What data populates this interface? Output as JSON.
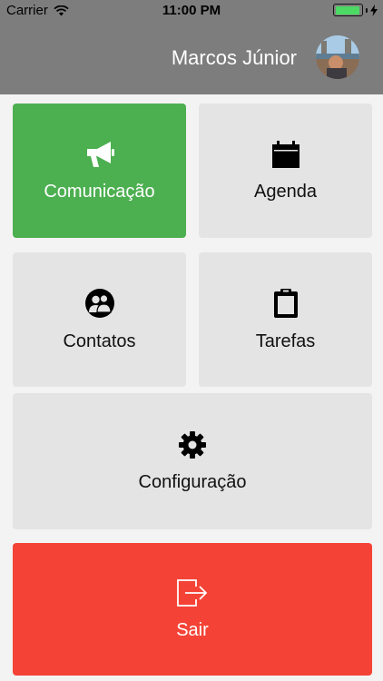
{
  "status_bar": {
    "carrier": "Carrier",
    "time": "11:00 PM",
    "battery_level": 0.95
  },
  "header": {
    "user_name": "Marcos Júnior"
  },
  "menu": {
    "comunicacao": {
      "label": "Comunicação",
      "icon": "megaphone-icon",
      "color": "#4caf50"
    },
    "agenda": {
      "label": "Agenda",
      "icon": "calendar-icon"
    },
    "contatos": {
      "label": "Contatos",
      "icon": "contacts-icon"
    },
    "tarefas": {
      "label": "Tarefas",
      "icon": "clipboard-icon"
    },
    "configuracao": {
      "label": "Configuração",
      "icon": "gear-icon"
    },
    "sair": {
      "label": "Sair",
      "icon": "logout-icon",
      "color": "#f44336"
    }
  }
}
